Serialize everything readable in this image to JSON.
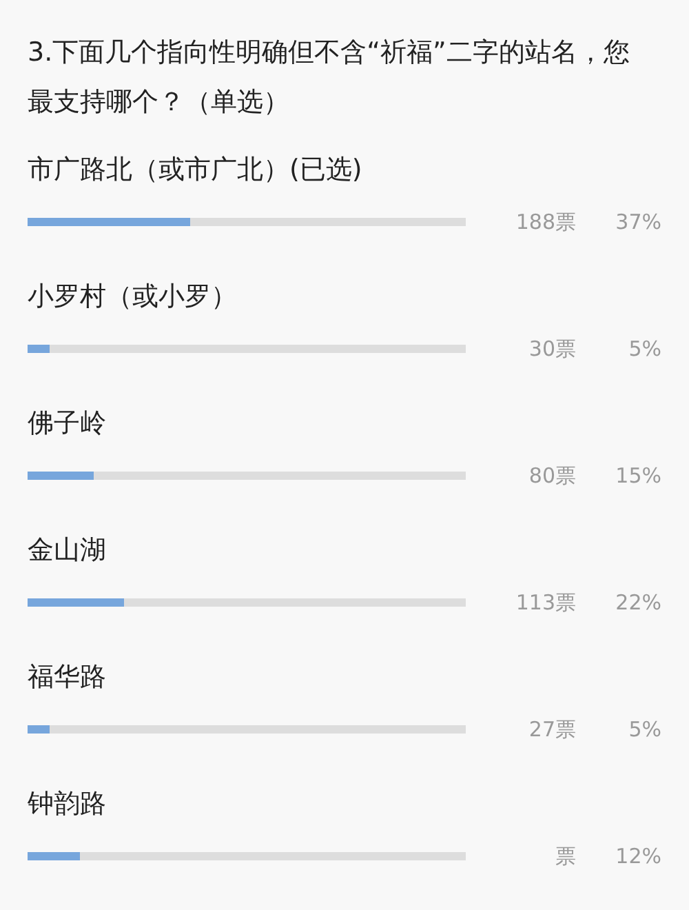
{
  "question": "3.下面几个指向性明确但不含“祈福”二字的站名，您最支持哪个？（单选）",
  "options": [
    {
      "label": "市广路北（或市广北）(已选)",
      "level": 0.37,
      "votes": "188票",
      "percent": "37%"
    },
    {
      "label": "小罗村（或小罗）",
      "level": 0.05,
      "votes": "30票",
      "percent": "5%"
    },
    {
      "label": "佛子岭",
      "level": 0.15,
      "votes": "80票",
      "percent": "15%"
    },
    {
      "label": "金山湖",
      "level": 0.22,
      "votes": "113票",
      "percent": "22%"
    },
    {
      "label": "福华路",
      "level": 0.05,
      "votes": "27票",
      "percent": "5%"
    },
    {
      "label": "钟韵路",
      "level": 0.12,
      "votes": "票",
      "percent": "12%"
    }
  ]
}
